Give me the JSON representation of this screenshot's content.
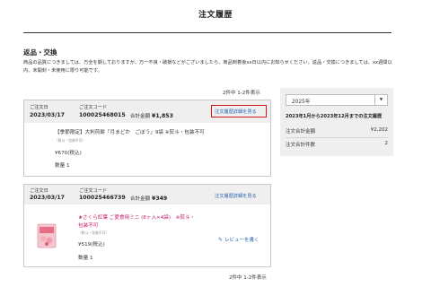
{
  "page": {
    "title": "注文履歴"
  },
  "returns": {
    "heading": "返品・交換",
    "text": "商品の品質につきましては、万全を期しておりますが、万一不良・破損などがございましたら、商品到着後xx日以内にお知らせください。返品・交換につきましては、xx週間以内、未開封・未使用に限り可能です。"
  },
  "pagination": {
    "count_top": "2件中 1-2件表示",
    "count_bottom": "2件中 1-2件表示"
  },
  "orders": [
    {
      "date_label": "ご注文日",
      "date": "2023/03/17",
      "code_label": "ご注文コード",
      "code": "100025468015",
      "total_label": "合計金額",
      "total": "¥1,853",
      "detail_link": "注文履歴詳細を見る",
      "item_name": "【季節限定】大判煎餅「月まどか　ごぼう」9袋 ※熨斗・包装不可",
      "item_note": "（熨斗・包装不可）",
      "item_price": "¥670(税込)",
      "item_qty": "数量 1"
    },
    {
      "date_label": "ご注文日",
      "date": "2023/03/17",
      "code_label": "ご注文コード",
      "code": "100025466739",
      "total_label": "合計金額",
      "total": "¥349",
      "detail_link": "注文履歴詳細を見る",
      "item_name_line1": "★さくら紅葉 ご愛食用ミニ (8ヶ入×4袋)　※熨斗・",
      "item_name_line2": "包装不可",
      "item_note": "（熨斗・包装不可）",
      "item_price": "¥519(税込)",
      "item_qty": "数量 1",
      "review_link": "レビューを書く",
      "review_icon": "pencil-icon"
    }
  ],
  "summary": {
    "year_select": "2025年",
    "period": "2023年1月から2023年12月までの注文履歴",
    "total_label": "注文合計金額",
    "total_value": "¥2,202",
    "count_label": "注文合計件数",
    "count_value": "2"
  },
  "colors": {
    "link": "#2a63b4",
    "highlight": "#d8161b",
    "pink_text": "#c51a66",
    "panel_bg": "#efefef"
  }
}
